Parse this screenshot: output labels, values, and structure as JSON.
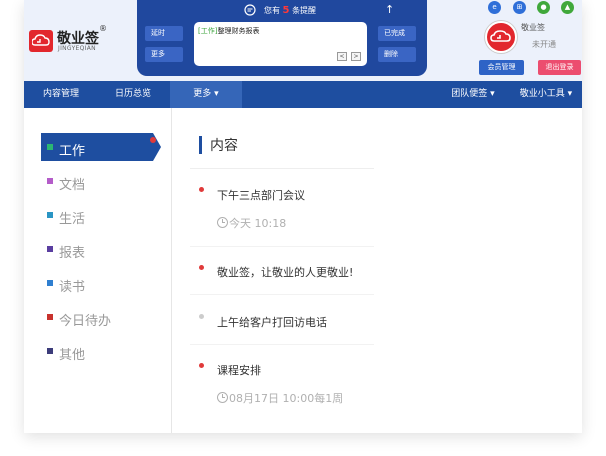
{
  "brand": {
    "name": "敬业签",
    "sub": "JINGYEQIAN",
    "reg": "®"
  },
  "reminder": {
    "prefix": "您有",
    "count": "5",
    "suffix": "条提醒"
  },
  "panel_buttons": {
    "later": "延时",
    "more": "更多",
    "done": "已完成",
    "delete": "删除"
  },
  "note": {
    "tag": "[工作]",
    "text": "整理财务报表"
  },
  "user": {
    "name": "敬业签",
    "state": "未开通"
  },
  "header_buttons": {
    "member": "会员管理",
    "logout": "退出登录"
  },
  "nav": {
    "content": "内容管理",
    "calendar": "日历总览",
    "more": "更多",
    "team": "团队便签",
    "tools": "敬业小工具"
  },
  "sidebar": [
    {
      "label": "工作",
      "color": "#2bb673"
    },
    {
      "label": "文档",
      "color": "#b45cc9"
    },
    {
      "label": "生活",
      "color": "#2a95c4"
    },
    {
      "label": "报表",
      "color": "#5a3ea0"
    },
    {
      "label": "读书",
      "color": "#2f7fd0"
    },
    {
      "label": "今日待办",
      "color": "#c8322d"
    },
    {
      "label": "其他",
      "color": "#3c3c7a"
    }
  ],
  "main": {
    "title": "内容",
    "entries": [
      {
        "title": "下午三点部门会议",
        "time": "今天 10:18",
        "dot": "#e03a3a"
      },
      {
        "title": "敬业签，让敬业的人更敬业!",
        "time": "",
        "dot": "#e03a3a"
      },
      {
        "title": "上午给客户打回访电话",
        "time": "",
        "dot": "#cccccc"
      },
      {
        "title": "课程安排",
        "time": "08月17日 10:00每1周",
        "dot": "#e03a3a"
      }
    ]
  }
}
